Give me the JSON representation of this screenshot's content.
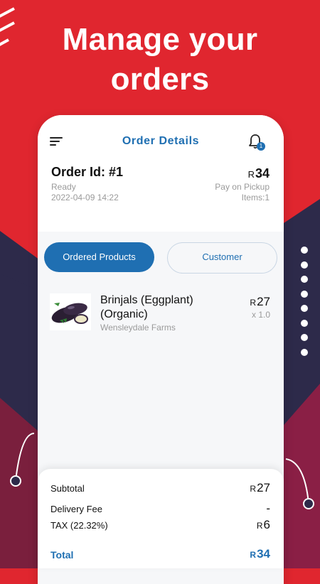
{
  "headline": {
    "line1": "Manage your",
    "line2": "orders"
  },
  "topbar": {
    "title": "Order Details",
    "notification_count": "1"
  },
  "order": {
    "id": "Order Id: #1",
    "status": "Ready",
    "date": "2022-04-09 14:22",
    "currency": "R",
    "amount": "34",
    "payment": "Pay on Pickup",
    "items": "Items:1"
  },
  "tabs": {
    "active": "Ordered Products",
    "inactive": "Customer"
  },
  "product": {
    "name": "Brinjals (Eggplant) (Organic)",
    "vendor": "Wensleydale Farms",
    "currency": "R",
    "price": "27",
    "qty": "x 1.0"
  },
  "summary": {
    "subtotal_label": "Subtotal",
    "subtotal_cur": "R",
    "subtotal": "27",
    "delivery_label": "Delivery Fee",
    "delivery": "-",
    "tax_label": "TAX (22.32%)",
    "tax_cur": "R",
    "tax": "6",
    "total_label": "Total",
    "total_cur": "R",
    "total": "34"
  },
  "colors": {
    "brand_red": "#e0262f",
    "navy": "#2d2a4a",
    "maroon": "#7a1f3d",
    "accent_blue": "#1f6fb2"
  }
}
